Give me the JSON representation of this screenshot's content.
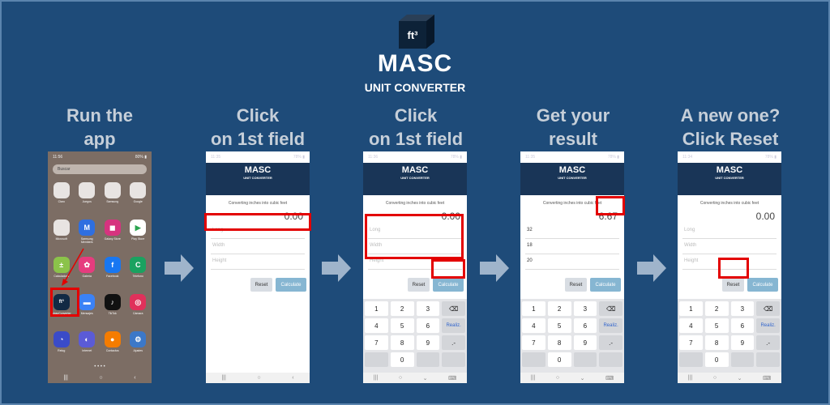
{
  "brand": {
    "logo_text": "ft³",
    "title": "MASC",
    "subtitle": "UNIT CONVERTER"
  },
  "steps": [
    {
      "title_line1": "Run the",
      "title_line2": "app"
    },
    {
      "title_line1": "Click",
      "title_line2": "on 1st field"
    },
    {
      "title_line1": "Click",
      "title_line2": "on 1st field"
    },
    {
      "title_line1": "Get your",
      "title_line2": "result"
    },
    {
      "title_line1": "A new one?",
      "title_line2": "Click Reset"
    }
  ],
  "home_screen": {
    "time": "11:56",
    "status_icons": "⊡ ◼ •",
    "battery": "80% ▮",
    "search_placeholder": "Buscar",
    "apps": [
      {
        "label": "Claro",
        "color": "#e8e4e2"
      },
      {
        "label": "Juegos",
        "color": "#e8e4e2"
      },
      {
        "label": "Samsung",
        "color": "#e8e4e2"
      },
      {
        "label": "Google",
        "color": "#e8e4e2"
      },
      {
        "label": "Microsoft",
        "color": "#e8e4e2"
      },
      {
        "label": "Samsung Members",
        "color": "#2f6fe0",
        "glyph": "M"
      },
      {
        "label": "Galaxy Store",
        "color": "#d6337f",
        "glyph": "◼"
      },
      {
        "label": "Play Store",
        "color": "#ffffff",
        "glyph": "▶"
      },
      {
        "label": "Calculadora",
        "color": "#8bc34a",
        "glyph": "±"
      },
      {
        "label": "Galería",
        "color": "#e63c7e",
        "glyph": "✿"
      },
      {
        "label": "Facebook",
        "color": "#1877f2",
        "glyph": "f"
      },
      {
        "label": "Telefono",
        "color": "#1aa260",
        "glyph": "C"
      },
      {
        "label": "MascConverter",
        "color": "#122a44",
        "glyph": "ft³"
      },
      {
        "label": "Mensajes",
        "color": "#3b82f6",
        "glyph": "▬"
      },
      {
        "label": "TikTok",
        "color": "#111111",
        "glyph": "♪"
      },
      {
        "label": "Cámara",
        "color": "#e0315b",
        "glyph": "◎"
      },
      {
        "label": "Relog",
        "color": "#3a4bc8",
        "glyph": "◔"
      },
      {
        "label": "Internet",
        "color": "#5b5bd6",
        "glyph": "◐"
      },
      {
        "label": "Contactos",
        "color": "#f57c00",
        "glyph": "●"
      },
      {
        "label": "Ajustes",
        "color": "#3c78c8",
        "glyph": "⚙"
      }
    ],
    "page_dots": "• • • •"
  },
  "converter": {
    "app_title": "MASC",
    "app_subtitle": "UNIT CONVERTER",
    "caption": "Converting inches into cubic feet",
    "reset_label": "Reset",
    "calculate_label": "Calculate",
    "placeholders": {
      "long": "Long",
      "width": "Width",
      "height": "Height"
    }
  },
  "screens": [
    {
      "time": "11:35",
      "battery": "78% ▮",
      "result": "0.00",
      "values": {
        "long": "",
        "width": "",
        "height": ""
      },
      "keypad": false
    },
    {
      "time": "11:36",
      "battery": "78% ▮",
      "result": "0.00",
      "values": {
        "long": "",
        "width": "",
        "height": ""
      },
      "keypad": true
    },
    {
      "time": "11:35",
      "battery": "78% ▮",
      "result": "6.67",
      "values": {
        "long": "32",
        "width": "18",
        "height": "20"
      },
      "keypad": true
    },
    {
      "time": "11:34",
      "battery": "78% ▮",
      "result": "0.00",
      "values": {
        "long": "",
        "width": "",
        "height": ""
      },
      "keypad": true
    }
  ],
  "keypad_keys": [
    "1",
    "2",
    "3",
    "⌫",
    "4",
    "5",
    "6",
    "Realiz.",
    "7",
    "8",
    "9",
    ".-",
    "",
    "0",
    "",
    ""
  ],
  "nav_bar": {
    "recents": "|||",
    "home": "○",
    "back": "‹"
  },
  "keyboard_nav_bar": {
    "recents": "|||",
    "home": "○",
    "back": "⌄",
    "kbd": "⌨"
  },
  "highlight_color": "#e30000"
}
